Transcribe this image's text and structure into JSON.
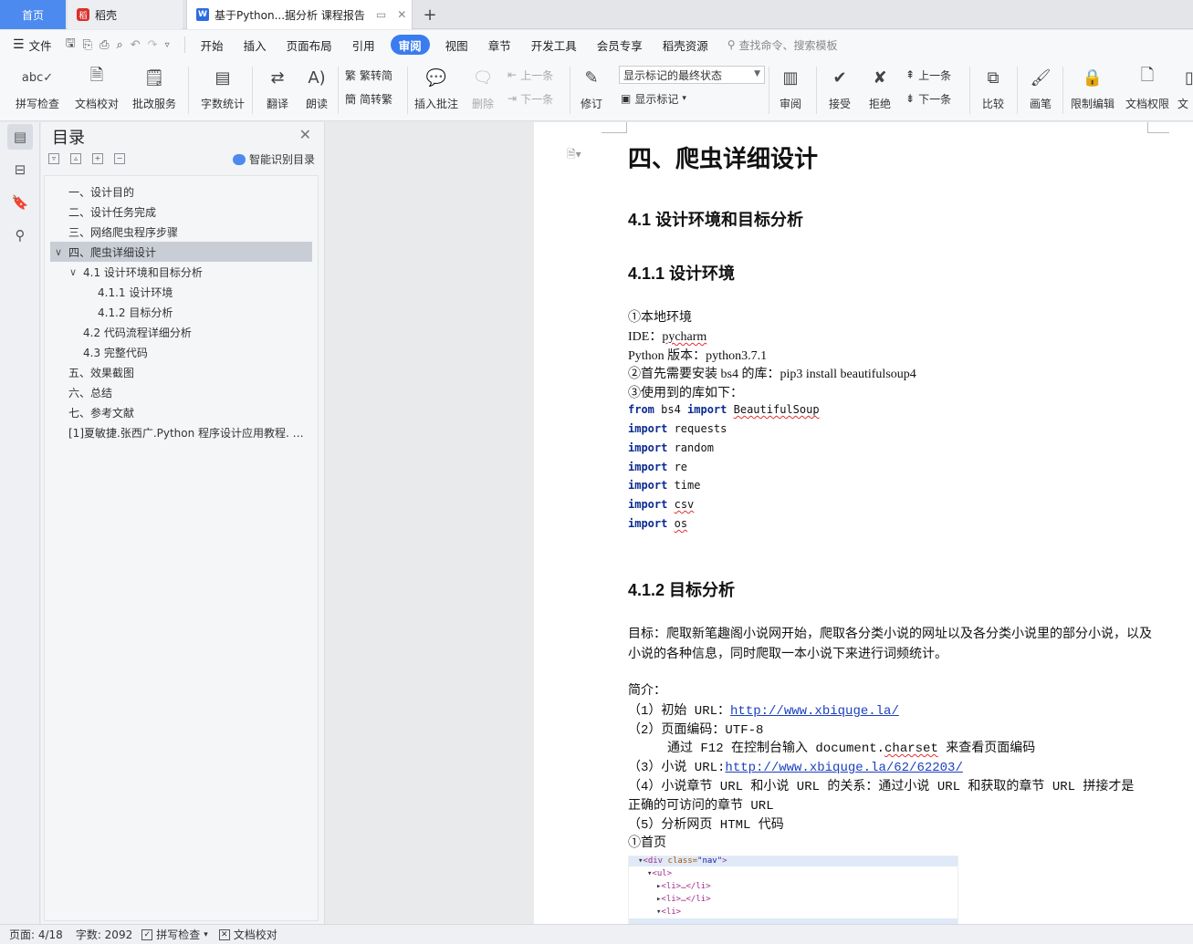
{
  "tabs": {
    "home": "首页",
    "daoke": "稻壳",
    "doc": "基于Python...据分析 课程报告",
    "daoke_logo": "稻",
    "doc_logo": "W",
    "add": "+"
  },
  "menu": {
    "file": "文件",
    "items": [
      "开始",
      "插入",
      "页面布局",
      "引用",
      "审阅",
      "视图",
      "章节",
      "开发工具",
      "会员专享",
      "稻壳资源"
    ],
    "active": "审阅",
    "search": "查找命令、搜索模板"
  },
  "ribbon": {
    "spell_check": "拼写检查",
    "doc_check": "文档校对",
    "correction_service": "批改服务",
    "word_count": "字数统计",
    "translate": "翻译",
    "read_aloud": "朗读",
    "trad_to_simp": "繁转简",
    "simp_to_trad": "简转繁",
    "insert_comment": "插入批注",
    "delete": "删除",
    "prev_comment": "上一条",
    "next_comment": "下一条",
    "track_changes": "修订",
    "markup_state": "显示标记的最终状态",
    "show_markup": "显示标记",
    "review": "审阅",
    "accept": "接受",
    "reject": "拒绝",
    "prev_change": "上一条",
    "next_change": "下一条",
    "compare": "比较",
    "pen": "画笔",
    "restrict_edit": "限制编辑",
    "doc_permission": "文档权限",
    "doc_cut": "文"
  },
  "toc": {
    "title": "目录",
    "smart": "智能识别目录",
    "items": [
      {
        "label": "一、设计目的",
        "level": 1
      },
      {
        "label": "二、设计任务完成",
        "level": 1
      },
      {
        "label": "三、网络爬虫程序步骤",
        "level": 1
      },
      {
        "label": "四、爬虫详细设计",
        "level": 1
      },
      {
        "label": "4.1 设计环境和目标分析",
        "level": 2
      },
      {
        "label": "4.1.1 设计环境",
        "level": 3
      },
      {
        "label": "4.1.2 目标分析",
        "level": 3
      },
      {
        "label": "4.2 代码流程详细分析",
        "level": 2
      },
      {
        "label": "4.3 完整代码",
        "level": 2
      },
      {
        "label": "五、效果截图",
        "level": 1
      },
      {
        "label": "六、总结",
        "level": 1
      },
      {
        "label": "七、参考文献",
        "level": 1
      },
      {
        "label": "[1]夏敏捷.张西广.Python 程序设计应用教程. …",
        "level": 1
      }
    ],
    "selected_index": 3
  },
  "doc": {
    "h1": "四、爬虫详细设计",
    "h2": "4.1 设计环境和目标分析",
    "h3a": "4.1.1 设计环境",
    "env1": "①本地环境",
    "ide_label": "IDE：",
    "ide_value": "pycharm",
    "pyver": "Python 版本：python3.7.1",
    "pip": "②首先需要安装 bs4 的库：pip3 install beautifulsoup4",
    "libs": "③使用到的库如下：",
    "code": {
      "l1_kw1": "from",
      "l1_mid": " bs4 ",
      "l1_kw2": "import",
      "l1_name": "BeautifulSoup",
      "imp": "import",
      "l2": " requests",
      "l3": " random",
      "l4": " re",
      "l5": " time",
      "l6": "csv",
      "l7": "os"
    },
    "h3b": "4.1.2 目标分析",
    "goal1": "目标：爬取新笔趣阁小说网开始，爬取各分类小说的网址以及各分类小说里的部分小说，以及",
    "goal2": "小说的各种信息，同时爬取一本小说下来进行词频统计。",
    "intro": "简介：",
    "i1_label": "（1）初始 URL：",
    "i1_link": "http://www.xbiquge.la/",
    "i2": "（2）页面编码：UTF-8",
    "i2b_pre": "通过 F12 在控制台输入 document.",
    "i2b_sq": "charset",
    "i2b_post": " 来查看页面编码",
    "i3_label": "（3）小说 URL:",
    "i3_link": "http://www.xbiquge.la/62/62203/",
    "i4a": "（4）小说章节 URL 和小说 URL 的关系：通过小说 URL 和获取的章节 URL 拼接才是",
    "i4b": "正确的可访问的章节 URL",
    "i5": "（5）分析网页 HTML 代码",
    "first": "①首页",
    "dev": {
      "l1_tag": "<div",
      "l1_attr": " class=",
      "l1_val": "\"nav\"",
      "l1_end": ">",
      "l2": "<ul>",
      "l3": "<li>…</li>",
      "l4": "<li>…</li>",
      "l5": "<li>"
    }
  },
  "status": {
    "page": "页面: 4/18",
    "words": "字数: 2092",
    "spell": "拼写检查",
    "proof": "文档校对"
  }
}
